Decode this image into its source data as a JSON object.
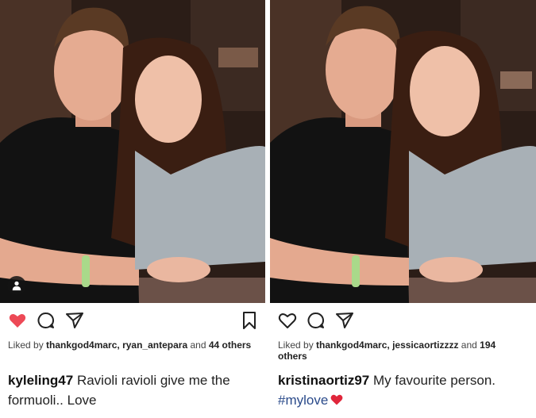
{
  "posts": [
    {
      "liked_prefix": "Liked by",
      "liked_names": "thankgod4marc, ryan_antepara",
      "liked_and": "and",
      "liked_count": "44",
      "liked_suffix": "others",
      "caption_user": "kyleling47",
      "caption_text": "Ravioli ravioli give me the formuoli.. Love",
      "like_active": true
    },
    {
      "liked_prefix": "Liked by",
      "liked_names": "thankgod4marc, jessicaortizzzz",
      "liked_and": "and",
      "liked_count": "194",
      "liked_suffix": "others",
      "caption_user": "kristinaortiz97",
      "caption_text": "My favourite person.",
      "caption_hashtag": "#mylove",
      "like_active": false
    }
  ],
  "icons": {
    "like": "heart-icon",
    "comment": "comment-icon",
    "share": "send-icon",
    "save": "bookmark-icon",
    "tag": "user-tag-icon",
    "emoji": "red-heart-emoji"
  },
  "colors": {
    "like_active": "#ed4956",
    "hashtag": "#2a4a8a",
    "text": "#222222"
  }
}
